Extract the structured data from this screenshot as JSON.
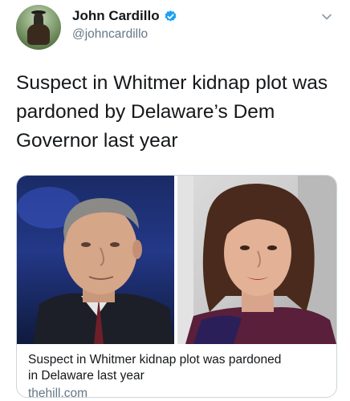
{
  "author": {
    "name": "John Cardillo",
    "handle": "@johncardillo",
    "verified": true,
    "avatar_icon": "avatar-rider-on-horse"
  },
  "tweet": {
    "lines": [
      "Suspect in Whitmer kidnap plot was",
      "pardoned by Delaware’s Dem",
      "Governor last year"
    ]
  },
  "card": {
    "title_lines": [
      "Suspect in Whitmer kidnap plot was pardoned",
      "in Delaware last year"
    ],
    "domain": "thehill.com",
    "images": [
      "photo-man-portrait",
      "photo-woman-portrait"
    ]
  },
  "colors": {
    "verified_blue": "#1da1f2",
    "secondary_text": "#657786",
    "border": "#ccd6dd"
  }
}
